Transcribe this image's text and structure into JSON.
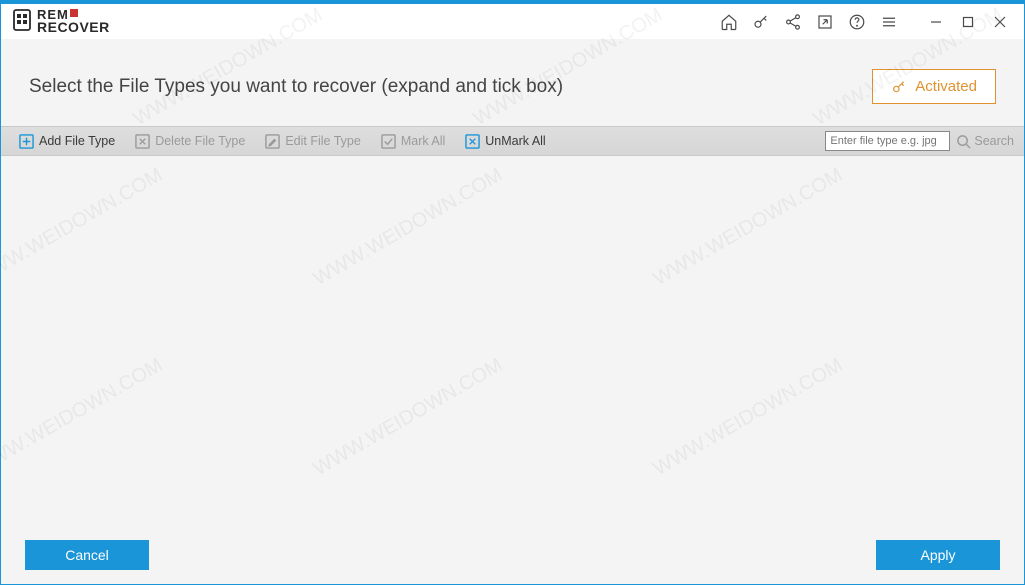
{
  "logo": {
    "line1": "rem",
    "line2": "RECOVER"
  },
  "header": {
    "title": "Select the File Types you want to recover (expand and tick box)",
    "activated_label": "Activated"
  },
  "toolbar": {
    "add_label": "Add File Type",
    "delete_label": "Delete File Type",
    "edit_label": "Edit File Type",
    "mark_all_label": "Mark All",
    "unmark_all_label": "UnMark All",
    "search_placeholder": "Enter file type e.g. jpg",
    "search_label": "Search"
  },
  "footer": {
    "cancel_label": "Cancel",
    "apply_label": "Apply"
  },
  "watermark_text": "WWW.WEIDOWN.COM",
  "colors": {
    "accent": "#1a95d8",
    "accent_orange": "#e0922f"
  }
}
